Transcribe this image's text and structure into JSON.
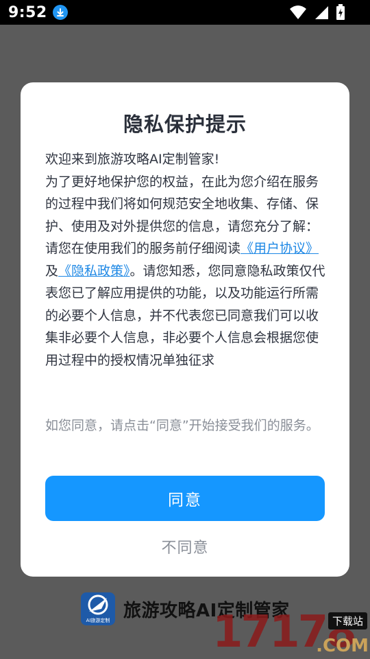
{
  "status_bar": {
    "time": "9:52"
  },
  "dialog": {
    "title": "隐私保护提示",
    "paragraphs": {
      "p1": "欢迎来到旅游攻略AI定制管家!",
      "p2": "为了更好地保护您的权益，在此为您介绍在服务的过程中我们将如何规范安全地收集、存储、保护、使用及对外提供您的信息，请您充分了解：",
      "p3_before": "请您在使用我们的服务前仔细阅读",
      "link_user_agreement": "《用户协议》",
      "p3_and": "及",
      "link_privacy_policy": "《隐私政策》",
      "p3_after": "。请您知悉，您同意隐私政策仅代表您已了解应用提供的功能，以及功能运行所需的必要个人信息，并不代表您已同意我们可以收集非必要个人信息，非必要个人信息会根据您使用过程中的授权情况单独征求"
    },
    "consent_note": "如您同意，请点击“同意”开始接受我们的服务。",
    "agree_label": "同意",
    "disagree_label": "不同意"
  },
  "brand": {
    "logo_text": "AI旅游定制",
    "name": "旅游攻略AI定制管家"
  },
  "watermark": {
    "digits": "17178",
    "tag": "下载站",
    "domain": ".COM"
  },
  "colors": {
    "accent": "#1597ff",
    "link": "#1e88e5",
    "overlay": "#5b5b5b"
  }
}
